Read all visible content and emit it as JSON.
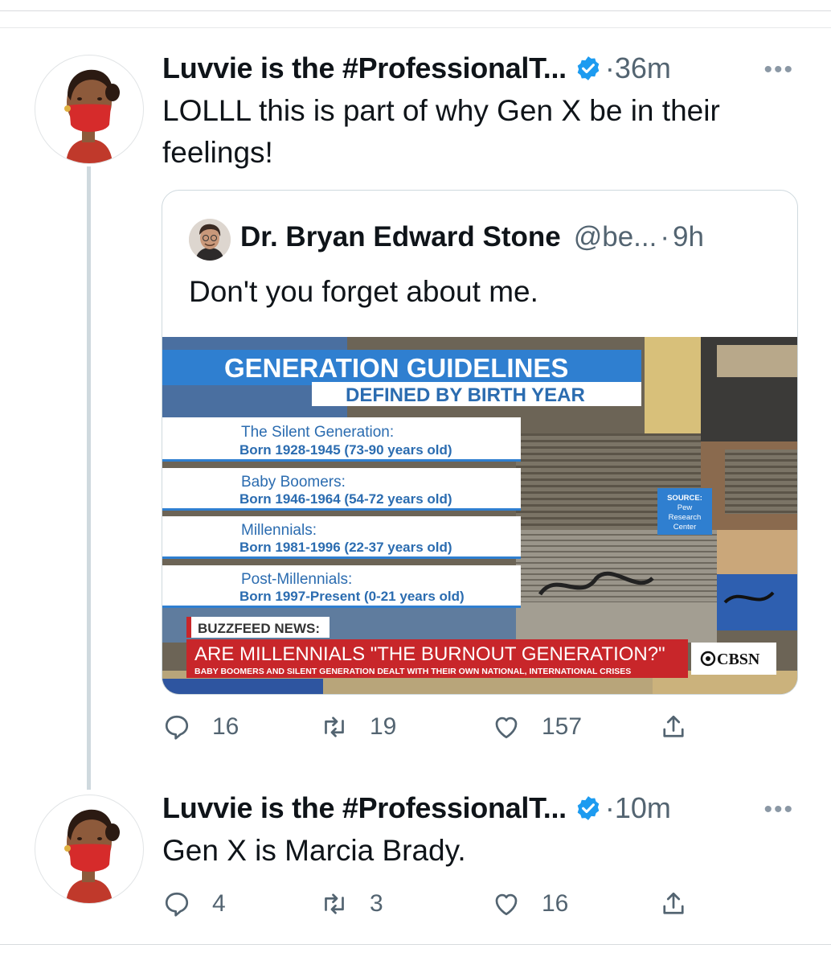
{
  "tweet1": {
    "name": "Luvvie is the #ProfessionalT...",
    "separator": "·",
    "time": "36m",
    "more": "•••",
    "text": "LOLLL this is part of why Gen X be in their feelings!",
    "icons": {
      "avatar": "masked-woman-avatar",
      "verified": "verified-badge-icon"
    },
    "quote": {
      "name": "Dr. Bryan Edward Stone",
      "handle": "@be...",
      "separator": "·",
      "time": "9h",
      "text": "Don't you forget about me.",
      "media": {
        "title": "GENERATION GUIDELINES",
        "subtitle": "DEFINED BY BIRTH YEAR",
        "generations": [
          {
            "name": "The Silent Generation:",
            "born": "Born 1928-1945 (73-90 years old)"
          },
          {
            "name": "Baby Boomers:",
            "born": "Born 1946-1964 (54-72 years old)"
          },
          {
            "name": "Millennials:",
            "born": "Born 1981-1996 (22-37 years old)"
          },
          {
            "name": "Post-Millennials:",
            "born": "Born 1997-Present (0-21 years old)"
          }
        ],
        "source_lines": [
          "SOURCE:",
          "Pew",
          "Research",
          "Center"
        ],
        "source_label": "BUZZFEED NEWS:",
        "headline": "ARE MILLENNIALS \"THE BURNOUT GENERATION?\"",
        "subheadline": "BABY BOOMERS AND SILENT GENERATION DEALT WITH THEIR OWN NATIONAL, INTERNATIONAL CRISES",
        "network": "CBSN",
        "colors": {
          "blue_banner": "#2f7fd0",
          "red_banner": "#c8262a",
          "text_blue": "#2b6cb0"
        }
      }
    },
    "actions": {
      "replies": "16",
      "retweets": "19",
      "likes": "157"
    }
  },
  "tweet2": {
    "name": "Luvvie is the #ProfessionalT...",
    "separator": "·",
    "time": "10m",
    "more": "•••",
    "text": "Gen X is Marcia Brady.",
    "actions": {
      "replies": "4",
      "retweets": "3",
      "likes": "16"
    }
  },
  "colors": {
    "verified_blue": "#1d9bf0",
    "muted_gray": "#536471",
    "border": "#cfd9de"
  }
}
